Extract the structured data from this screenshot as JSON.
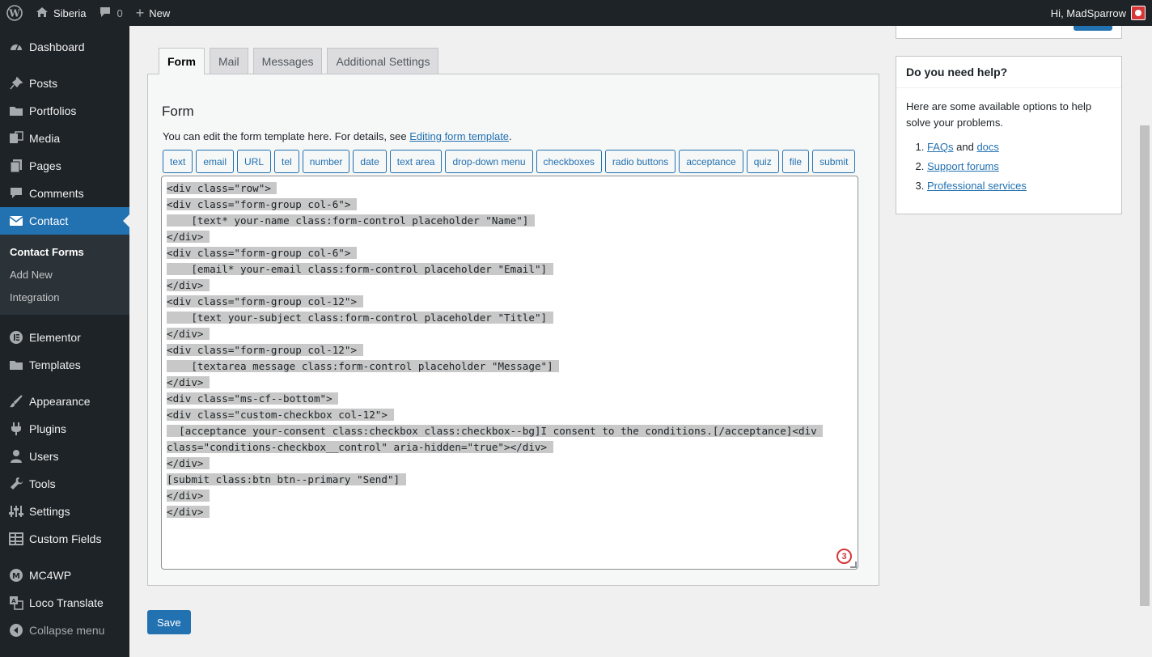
{
  "adminbar": {
    "site_name": "Siberia",
    "comments_count": "0",
    "new_label": "New",
    "greeting": "Hi, MadSparrow"
  },
  "sidebar": {
    "items": [
      {
        "label": "Dashboard",
        "icon": "dashboard-icon"
      },
      {
        "label": "Posts",
        "icon": "pin-icon"
      },
      {
        "label": "Portfolios",
        "icon": "folder-icon"
      },
      {
        "label": "Media",
        "icon": "media-icon"
      },
      {
        "label": "Pages",
        "icon": "pages-icon"
      },
      {
        "label": "Comments",
        "icon": "comment-icon"
      },
      {
        "label": "Contact",
        "icon": "mail-icon"
      },
      {
        "label": "Elementor",
        "icon": "elementor-icon"
      },
      {
        "label": "Templates",
        "icon": "folder-icon"
      },
      {
        "label": "Appearance",
        "icon": "brush-icon"
      },
      {
        "label": "Plugins",
        "icon": "plug-icon"
      },
      {
        "label": "Users",
        "icon": "user-icon"
      },
      {
        "label": "Tools",
        "icon": "wrench-icon"
      },
      {
        "label": "Settings",
        "icon": "sliders-icon"
      },
      {
        "label": "Custom Fields",
        "icon": "table-icon"
      },
      {
        "label": "MC4WP",
        "icon": "mc4wp-icon"
      },
      {
        "label": "Loco Translate",
        "icon": "translate-icon"
      },
      {
        "label": "Collapse menu",
        "icon": "collapse-icon"
      }
    ],
    "submenu": [
      "Contact Forms",
      "Add New",
      "Integration"
    ]
  },
  "tabs": [
    "Form",
    "Mail",
    "Messages",
    "Additional Settings"
  ],
  "form": {
    "heading": "Form",
    "description": "You can edit the form template here. For details, see ",
    "description_link": "Editing form template",
    "description_end": ".",
    "tag_buttons": [
      "text",
      "email",
      "URL",
      "tel",
      "number",
      "date",
      "text area",
      "drop-down menu",
      "checkboxes",
      "radio buttons",
      "acceptance",
      "quiz",
      "file",
      "submit"
    ],
    "code_lines": [
      "<div class=\"row\">",
      "<div class=\"form-group col-6\">",
      "    [text* your-name class:form-control placeholder \"Name\"]",
      "</div>",
      "<div class=\"form-group col-6\">",
      "    [email* your-email class:form-control placeholder \"Email\"]",
      "</div>",
      "<div class=\"form-group col-12\">",
      "    [text your-subject class:form-control placeholder \"Title\"]",
      "</div>",
      "<div class=\"form-group col-12\">",
      "    [textarea message class:form-control placeholder \"Message\"]",
      "</div>",
      "<div class=\"ms-cf--bottom\">",
      "<div class=\"custom-checkbox col-12\">",
      "  [acceptance your-consent class:checkbox class:checkbox--bg]I consent to the conditions.[/acceptance]<div class=\"conditions-checkbox__control\" aria-hidden=\"true\"></div>",
      "</div>",
      "[submit class:btn btn--primary \"Send\"]",
      "</div>",
      "</div>"
    ],
    "badge_count": "3",
    "save_label": "Save"
  },
  "help": {
    "title": "Do you need help?",
    "text": "Here are some available options to help solve your problems.",
    "item1_a": "FAQs",
    "item1_and": " and ",
    "item1_b": "docs",
    "item2": "Support forums",
    "item3": "Professional services"
  },
  "colors": {
    "accent": "#2271b1",
    "sidebar": "#1d2327",
    "badge": "#d63638"
  }
}
